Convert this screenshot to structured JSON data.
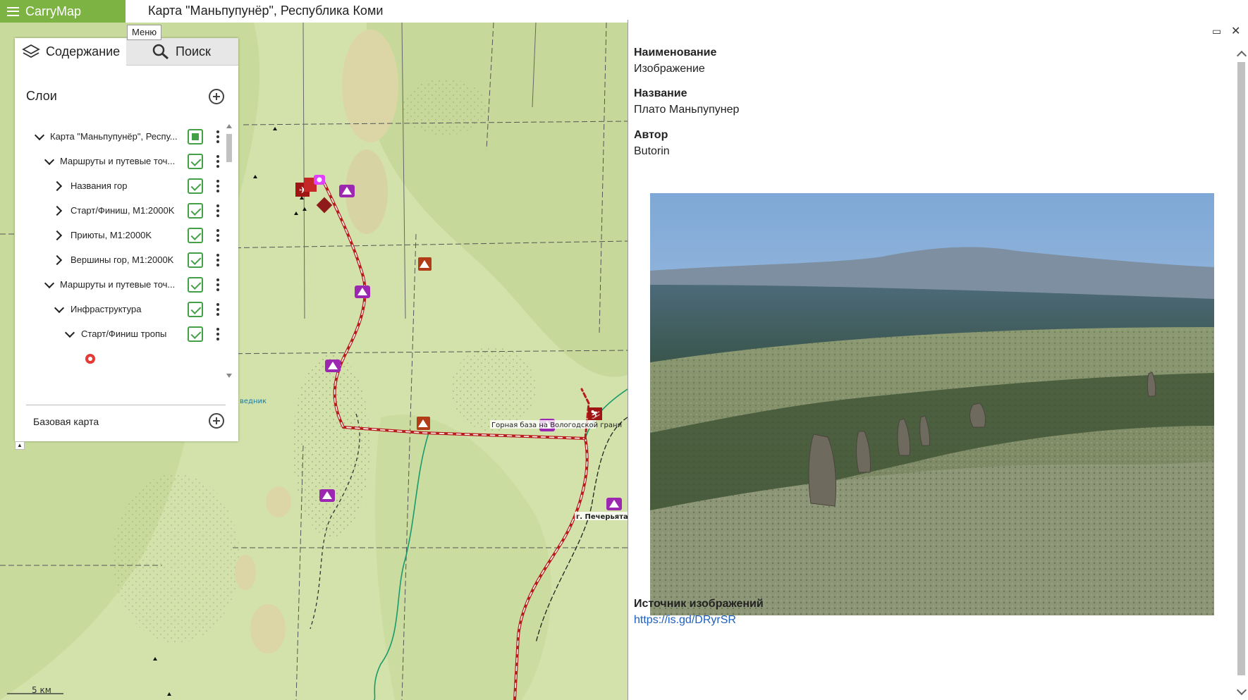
{
  "app": {
    "brand": "CarryMap",
    "map_title": "Карта \"Маньпупунёр\", Республика Коми",
    "menu_tooltip": "Меню",
    "brand_color": "#7cb342"
  },
  "layers_panel": {
    "tabs": [
      {
        "label": "Содержание",
        "icon": "layers-icon",
        "active": true
      },
      {
        "label": "Поиск",
        "icon": "search-icon",
        "active": false
      }
    ],
    "heading": "Слои",
    "tree": [
      {
        "label": "Карта \"Маньпупунёр\", Респу...",
        "expanded": true,
        "state": "partial"
      },
      {
        "label": "Маршруты и путевые точ...",
        "expanded": true,
        "state": "checked"
      },
      {
        "label": "Названия гор",
        "expanded": false,
        "state": "checked"
      },
      {
        "label": "Старт/Финиш, М1:2000K",
        "expanded": false,
        "state": "checked"
      },
      {
        "label": "Приюты, М1:2000K",
        "expanded": false,
        "state": "checked"
      },
      {
        "label": "Вершины гор, М1:2000K",
        "expanded": false,
        "state": "checked"
      },
      {
        "label": "Маршруты и путевые точ...",
        "expanded": true,
        "state": "checked"
      },
      {
        "label": "Инфраструктура",
        "expanded": true,
        "state": "checked"
      },
      {
        "label": "Старт/Финиш тропы",
        "expanded": true,
        "state": "checked"
      }
    ],
    "basemap_label": "Базовая карта"
  },
  "map": {
    "labels": {
      "base": "Горная база на Вологодской грани",
      "peak": "г. Печерьяталл",
      "scale": "5 км",
      "partial": "ведник"
    },
    "colors": {
      "background": "#d6e4b0",
      "route": "#b71c1c",
      "river": "#1a9a6c",
      "poi_purple": "#9c27b0",
      "shelter": "#b23c17"
    }
  },
  "info_panel": {
    "fields": [
      {
        "label": "Наименование",
        "value": "Изображение"
      },
      {
        "label": "Название",
        "value": "Плато Маньпупунер"
      },
      {
        "label": "Автор",
        "value": "Butorin"
      }
    ],
    "source_label": "Источник изображений",
    "source_link": "https://is.gd/DRyrSR"
  }
}
